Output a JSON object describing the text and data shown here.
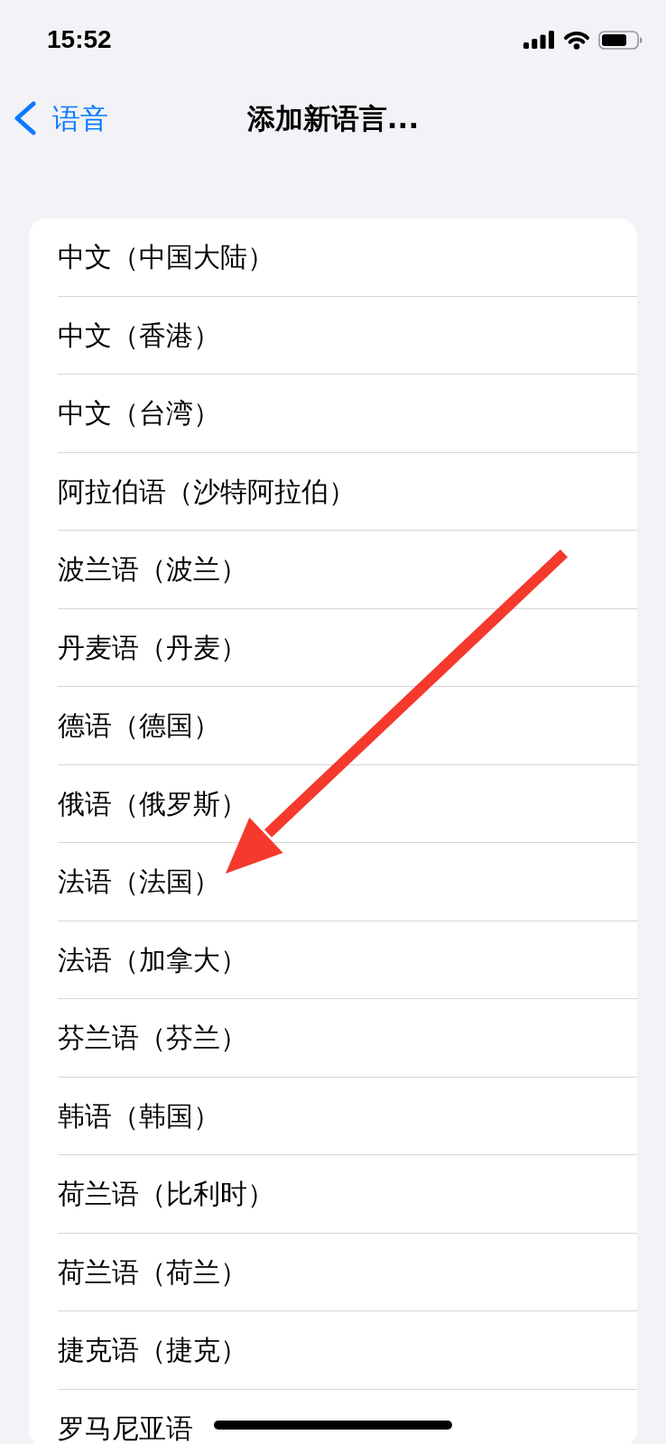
{
  "status_bar": {
    "time": "15:52"
  },
  "nav_bar": {
    "back_label": "语音",
    "title": "添加新语言..."
  },
  "languages": [
    {
      "label": "中文（中国大陆）"
    },
    {
      "label": "中文（香港）"
    },
    {
      "label": "中文（台湾）"
    },
    {
      "label": "阿拉伯语（沙特阿拉伯）"
    },
    {
      "label": "波兰语（波兰）"
    },
    {
      "label": "丹麦语（丹麦）"
    },
    {
      "label": "德语（德国）"
    },
    {
      "label": "俄语（俄罗斯）"
    },
    {
      "label": "法语（法国）"
    },
    {
      "label": "法语（加拿大）"
    },
    {
      "label": "芬兰语（芬兰）"
    },
    {
      "label": "韩语（韩国）"
    },
    {
      "label": "荷兰语（比利时）"
    },
    {
      "label": "荷兰语（荷兰）"
    },
    {
      "label": "捷克语（捷克）"
    },
    {
      "label": "罗马尼亚语"
    }
  ]
}
